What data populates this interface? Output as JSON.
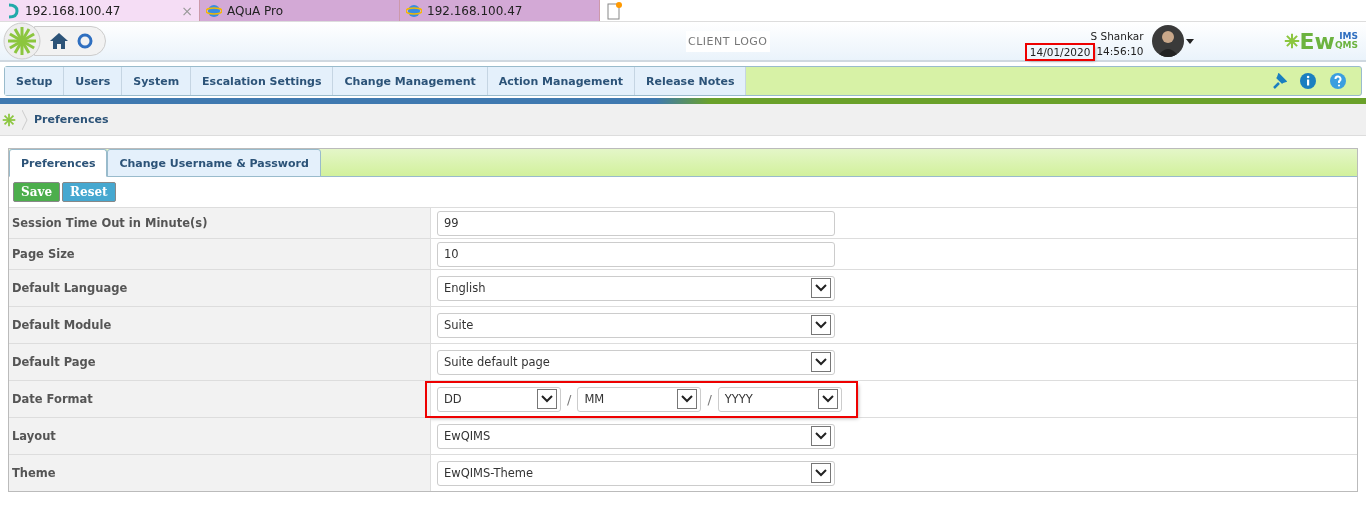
{
  "browser_tabs": [
    {
      "label": "192.168.100.47",
      "selected": true,
      "close": "×"
    },
    {
      "label": "AQuA Pro",
      "selected": false
    },
    {
      "label": "192.168.100.47",
      "selected": false
    }
  ],
  "header": {
    "client_logo": "CLIENT LOGO",
    "user_name": "S Shankar",
    "date": "14/01/2020",
    "time": "14:56:10",
    "date_highlighted": true,
    "brand": {
      "main": "Ew",
      "top": "IMS",
      "bottom": "QMS"
    }
  },
  "menu": [
    "Setup",
    "Users",
    "System",
    "Escalation Settings",
    "Change Management",
    "Action Management",
    "Release Notes"
  ],
  "breadcrumb": "Preferences",
  "tabs": [
    {
      "label": "Preferences",
      "selected": true
    },
    {
      "label": "Change Username & Password",
      "selected": false
    }
  ],
  "buttons": [
    {
      "label": "Save",
      "kind": "save"
    },
    {
      "label": "Reset",
      "kind": "reset"
    }
  ],
  "rows": [
    {
      "label": "Session Time Out in Minute(s)",
      "kind": "text",
      "value": "99"
    },
    {
      "label": "Page Size",
      "kind": "text",
      "value": "10"
    },
    {
      "label": "Default Language",
      "kind": "select",
      "value": "English"
    },
    {
      "label": "Default Module",
      "kind": "select",
      "value": "Suite"
    },
    {
      "label": "Default Page",
      "kind": "select",
      "value": "Suite default page"
    },
    {
      "label": "Date Format",
      "kind": "date",
      "parts": [
        "DD",
        "MM",
        "YYYY"
      ],
      "separator": "/",
      "highlighted": true
    },
    {
      "label": "Layout",
      "kind": "select",
      "value": "EwQIMS"
    },
    {
      "label": "Theme",
      "kind": "select",
      "value": "EwQIMS-Theme"
    }
  ]
}
